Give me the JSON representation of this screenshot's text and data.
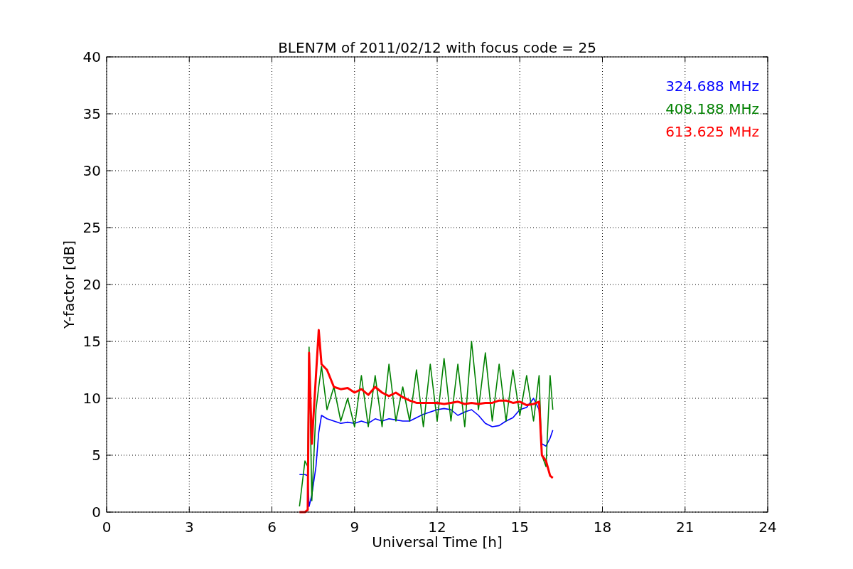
{
  "chart_data": {
    "type": "line",
    "title": "BLEN7M of 2011/02/12 with focus code = 25",
    "xlabel": "Universal Time [h]",
    "ylabel": "Y-factor [dB]",
    "x": [
      7.0,
      7.2,
      7.3,
      7.35,
      7.45,
      7.6,
      7.7,
      7.8,
      8.0,
      8.25,
      8.5,
      8.75,
      9.0,
      9.25,
      9.5,
      9.75,
      10.0,
      10.25,
      10.5,
      10.75,
      11.0,
      11.25,
      11.5,
      11.75,
      12.0,
      12.25,
      12.5,
      12.75,
      13.0,
      13.25,
      13.5,
      13.75,
      14.0,
      14.25,
      14.5,
      14.75,
      15.0,
      15.25,
      15.5,
      15.7,
      15.8,
      15.95,
      16.1,
      16.2
    ],
    "series": [
      {
        "name": "324.688 MHz",
        "color": "#0000ff",
        "values": [
          3.3,
          3.3,
          3.2,
          0.5,
          1.5,
          4,
          7,
          8.5,
          8.2,
          8,
          7.8,
          7.9,
          7.8,
          8,
          7.8,
          8.2,
          8,
          8.2,
          8.1,
          8,
          8,
          8.3,
          8.6,
          8.8,
          9,
          9.1,
          9,
          8.5,
          8.8,
          9,
          8.5,
          7.8,
          7.5,
          7.6,
          8,
          8.3,
          9,
          9.2,
          10,
          9.0,
          6,
          5.8,
          6.5,
          7.2
        ]
      },
      {
        "name": "408.188 MHz",
        "color": "#008000",
        "values": [
          0.5,
          4.5,
          4,
          14.5,
          1,
          9,
          11,
          12.8,
          9,
          11,
          8,
          10,
          7.5,
          12,
          7.5,
          12,
          7.5,
          13,
          8,
          11,
          8,
          12.5,
          7.5,
          13,
          8,
          13.5,
          8,
          13,
          7.5,
          15,
          9,
          14,
          8,
          13,
          8,
          12.5,
          8.5,
          12,
          8,
          12,
          5,
          4,
          12,
          9
        ]
      },
      {
        "name": "613.625 MHz",
        "color": "#ff0000",
        "values": [
          0,
          0,
          0.2,
          14,
          6,
          12,
          16,
          13,
          12.5,
          11,
          10.8,
          10.9,
          10.5,
          10.8,
          10.3,
          11,
          10.5,
          10.2,
          10.5,
          10.1,
          9.8,
          9.6,
          9.6,
          9.6,
          9.6,
          9.5,
          9.6,
          9.7,
          9.5,
          9.6,
          9.5,
          9.6,
          9.6,
          9.8,
          9.8,
          9.6,
          9.7,
          9.4,
          9.5,
          9.7,
          5,
          4.5,
          3.2,
          3
        ]
      }
    ],
    "xlim": [
      0,
      24
    ],
    "ylim": [
      0,
      40
    ],
    "xticks": [
      0,
      3,
      6,
      9,
      12,
      15,
      18,
      21,
      24
    ],
    "yticks": [
      0,
      5,
      10,
      15,
      20,
      25,
      30,
      35,
      40
    ],
    "grid": true
  }
}
